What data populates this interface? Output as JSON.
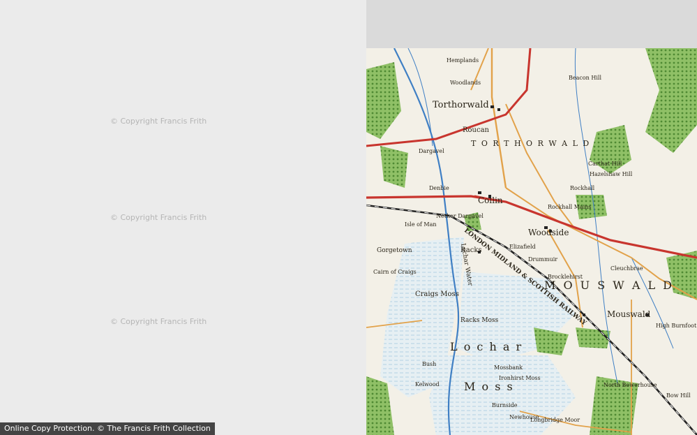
{
  "watermark": "© Copyright Francis Frith",
  "footer_text": "Online Copy Protection. © The Francis Frith Collection",
  "colors": {
    "woodland": "#5e9a3d",
    "moss": "#a7cbe0",
    "river": "#3f7fc4",
    "road_main": "#c8352e",
    "road_minor": "#e2a24a",
    "railway": "#222222"
  },
  "map": {
    "places": {
      "torthorwald": "Torthorwald",
      "torthorwald_parish": "T O R T H O R W A L D",
      "collin": "Collin",
      "roucan": "Roucan",
      "woodside": "Woodside",
      "mouswald": "Mouswald",
      "mouswald_parish": "M O U S W A L D",
      "lochar_moss_label": "L o c h a r",
      "moss_label": "M o s s",
      "racks": "Racks",
      "racks_moss": "Racks Moss",
      "craigs_moss": "Craigs Moss",
      "craigs": "Craigs",
      "gorgetown": "Gorgetown",
      "cairn_of_craigs": "Cairn of Craigs",
      "isle_of_man": "Isle of Man",
      "mossbank": "Mossbank",
      "ironhirst_moss": "Ironhirst Moss",
      "elizafield": "Elizafield",
      "drummuir": "Drummuir",
      "carthat_hill": "Carthat Hill",
      "beacon_hill": "Beacon Hill",
      "rockhall": "Rockhall",
      "rockhall_mains": "Rockhall Mains",
      "brocklehirst": "Brocklehirst",
      "north_bowerhouse": "North Bowerhouse",
      "longbridge_moor": "Longbridge Moor",
      "newhouse": "Newhouse",
      "burnside": "Burnside",
      "bush": "Bush",
      "kelwood": "Kelwood",
      "dargavel": "Dargavel",
      "nether_dargavel": "Nether Dargavel",
      "denbie": "Denbie",
      "hemplands": "Hemplands",
      "woodlands": "Woodlands",
      "lochar_water": "Lochar Water",
      "railway_label": "LONDON MIDLAND & SCOTTISH RAILWAY",
      "hazelshaw_hill": "Hazelshaw Hill",
      "high_burnfoot": "High Burnfoot",
      "cleuchbrae": "Cleuchbrae",
      "bow_hill": "Bow Hill"
    }
  }
}
